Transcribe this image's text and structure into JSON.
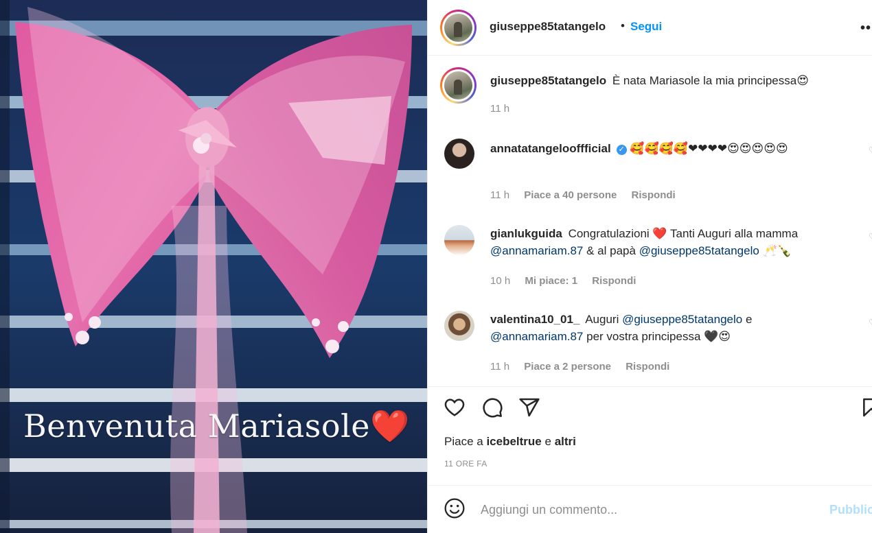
{
  "post": {
    "image_caption_text": "Benvenuta Mariasole",
    "image_caption_emoji": "❤️"
  },
  "header": {
    "username": "giuseppe85tatangelo",
    "separator": "•",
    "follow_label": "Segui",
    "more_label": "••"
  },
  "caption": {
    "username": "giuseppe85tatangelo",
    "text": "È nata Mariasole la mia principessa",
    "emoji": "😍",
    "time": "11 h"
  },
  "comments": [
    {
      "username": "annatatangelooffficial",
      "verified": true,
      "text": "🥰🥰🥰🥰❤❤❤❤😍😍😍😍😍",
      "time": "11 h",
      "likes": "Piace a 40 persone",
      "reply": "Rispondi"
    },
    {
      "username": "gianlukguida",
      "text_1": "Congratulazioni ❤️ Tanti Auguri alla mamma",
      "mention_1": "@annamariam.87",
      "text_2": "& al papà",
      "mention_2": "@giuseppe85tatangelo",
      "emoji": "🥂🍾",
      "time": "10 h",
      "likes": "Mi piace: 1",
      "reply": "Rispondi"
    },
    {
      "username": "valentina10_01_",
      "text_1": "Auguri",
      "mention_1": "@giuseppe85tatangelo",
      "text_2": "e",
      "mention_2": "@annamariam.87",
      "text_3": "per vostra principessa",
      "emoji": "🖤😍",
      "time": "11 h",
      "likes": "Piace a 2 persone",
      "reply": "Rispondi"
    }
  ],
  "actions": {
    "icons": [
      "heart-icon",
      "comment-icon",
      "share-icon",
      "bookmark-icon"
    ],
    "likes_prefix": "Piace a",
    "likes_user": "icebeltrue",
    "likes_and": "e",
    "likes_others": "altri",
    "timestamp": "11 ORE FA"
  },
  "add_comment": {
    "placeholder": "Aggiungi un commento...",
    "publish_label": "Pubblica"
  },
  "colors": {
    "link_blue": "#0095f6",
    "mention_blue": "#00376b",
    "muted_gray": "#8e8e8e",
    "publish_disabled": "#b2dffc"
  }
}
